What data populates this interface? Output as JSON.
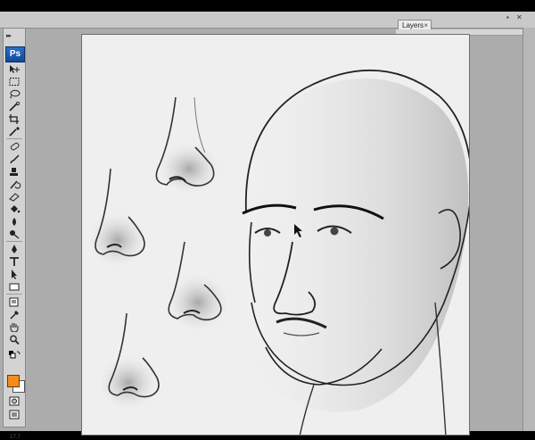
{
  "app": {
    "logo": "Ps",
    "collapse_glyph": "▸▸",
    "zoom_readout": "17.7"
  },
  "toolbar": {
    "tools": [
      "move-tool-icon",
      "marquee-tool-icon",
      "lasso-tool-icon",
      "quick-select-tool-icon",
      "crop-tool-icon",
      "eyedropper-tool-icon",
      "spot-heal-tool-icon",
      "brush-tool-icon",
      "clone-stamp-tool-icon",
      "history-brush-tool-icon",
      "eraser-tool-icon",
      "paint-bucket-tool-icon",
      "blur-tool-icon",
      "dodge-tool-icon",
      "pen-tool-icon",
      "type-tool-icon",
      "path-select-tool-icon",
      "shape-tool-icon",
      "notes-tool-icon",
      "eyedropper-3d-tool-icon",
      "hand-tool-icon",
      "zoom-tool-icon"
    ],
    "colors": {
      "foreground": "#f28c1a",
      "background": "#ffffff"
    },
    "mode_icons": [
      "quick-mask-icon",
      "screen-mode-icon"
    ]
  },
  "panels": {
    "layers_tab_label": "Layers",
    "close_glyph": "×",
    "minimize_glyph": "▪",
    "panel_close_glyph": "✕"
  },
  "document": {
    "content": "pencil sketch of five noses and a male head"
  },
  "colors": {
    "workspace": "#acacac",
    "canvas": "#efefef",
    "accent": "#2a6fc0"
  }
}
